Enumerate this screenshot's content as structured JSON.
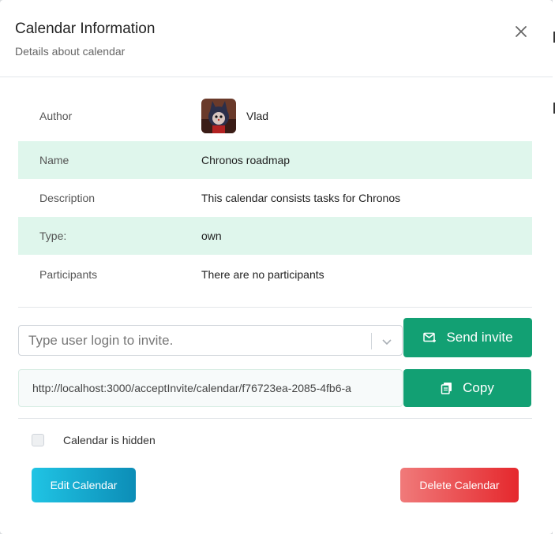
{
  "header": {
    "title": "Calendar Information",
    "subtitle": "Details about calendar",
    "close_icon": "close-icon"
  },
  "info": {
    "author_label": "Author",
    "author_name": "Vlad",
    "name_label": "Name",
    "name_value": "Chronos roadmap",
    "description_label": "Description",
    "description_value": "This calendar consists tasks for Chronos",
    "type_label": "Type:",
    "type_value": "own",
    "participants_label": "Participants",
    "participants_value": "There are no participants"
  },
  "invite": {
    "placeholder": "Type user login to invite.",
    "send_label": "Send invite",
    "link": "http://localhost:3000/acceptInvite/calendar/f76723ea-2085-4fb6-a",
    "copy_label": "Copy"
  },
  "options": {
    "hidden_label": "Calendar is hidden",
    "hidden_checked": false
  },
  "actions": {
    "edit_label": "Edit Calendar",
    "delete_label": "Delete Calendar"
  },
  "colors": {
    "accent_green": "#12a073",
    "row_highlight": "#dff6ec",
    "edit_gradient": [
      "#20c4e4",
      "#0c8db7"
    ],
    "delete_gradient": [
      "#f07a7a",
      "#e5282d"
    ]
  }
}
